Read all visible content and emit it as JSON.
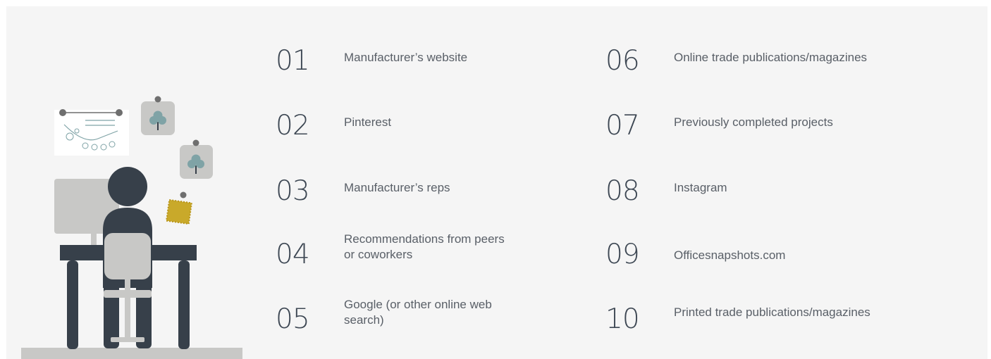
{
  "items": [
    {
      "number": "01",
      "label": "Manufacturer’s website"
    },
    {
      "number": "02",
      "label": "Pinterest"
    },
    {
      "number": "03",
      "label": "Manufacturer’s reps"
    },
    {
      "number": "04",
      "label": "Recommendations from peers or coworkers"
    },
    {
      "number": "05",
      "label": "Google (or other online web search)"
    },
    {
      "number": "06",
      "label": "Online trade publications/magazines"
    },
    {
      "number": "07",
      "label": "Previously completed projects"
    },
    {
      "number": "08",
      "label": "Instagram"
    },
    {
      "number": "09",
      "label": "Officesnapshots.com"
    },
    {
      "number": "10",
      "label": "Printed trade publications/magazines"
    }
  ],
  "colors": {
    "background": "#f5f5f5",
    "number_text": "#3d4753",
    "label_text": "#595f67",
    "figure_dark": "#37404a",
    "monitor_gray": "#c8c8c6",
    "tree_teal": "#7fa3a6",
    "swatch_gold": "#c9a92a"
  },
  "illustration": {
    "icons": [
      "whiteboard-icon",
      "tree-card-icon",
      "fabric-swatch-icon",
      "person-at-desk-icon"
    ]
  }
}
